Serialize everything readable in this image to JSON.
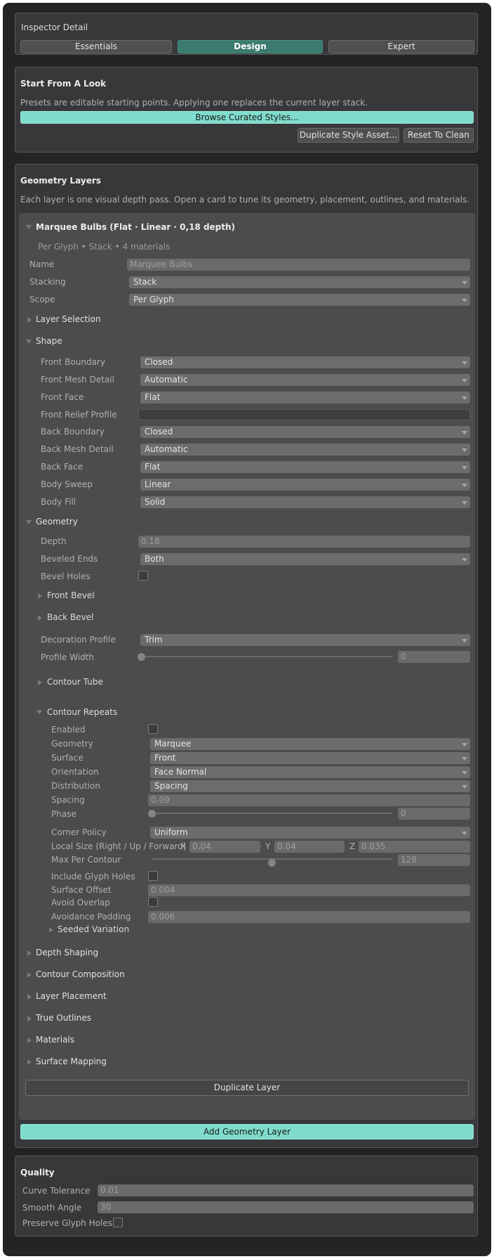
{
  "header": {
    "title": "Inspector Detail",
    "tabs": [
      "Essentials",
      "Design",
      "Expert"
    ],
    "active_tab": "Design"
  },
  "look": {
    "title": "Start From A Look",
    "desc": "Presets are editable starting points. Applying one replaces the current layer stack.",
    "browse": "Browse Curated Styles...",
    "duplicate": "Duplicate Style Asset...",
    "reset": "Reset To Clean"
  },
  "layers": {
    "title": "Geometry Layers",
    "desc": "Each layer is one visual depth pass. Open a card to tune its geometry, placement, outlines, and materials.",
    "add": "Add Geometry Layer"
  },
  "card": {
    "title": "Marquee Bulbs (Flat · Linear · 0,18 depth)",
    "subtitle": "Per Glyph • Stack • 4 materials",
    "name_label": "Name",
    "name_value": "Marquee Bulbs",
    "stacking_label": "Stacking",
    "stacking_value": "Stack",
    "scope_label": "Scope",
    "scope_value": "Per Glyph",
    "layer_selection": "Layer Selection",
    "shape": {
      "title": "Shape",
      "rows": [
        {
          "label": "Front Boundary",
          "value": "Closed"
        },
        {
          "label": "Front Mesh Detail",
          "value": "Automatic"
        },
        {
          "label": "Front Face",
          "value": "Flat"
        },
        {
          "label": "Front Relief Profile",
          "value": ""
        },
        {
          "label": "Back Boundary",
          "value": "Closed"
        },
        {
          "label": "Back Mesh Detail",
          "value": "Automatic"
        },
        {
          "label": "Back Face",
          "value": "Flat"
        },
        {
          "label": "Body Sweep",
          "value": "Linear"
        },
        {
          "label": "Body Fill",
          "value": "Solid"
        }
      ]
    },
    "geometry": {
      "title": "Geometry",
      "depth_label": "Depth",
      "depth_value": "0.18",
      "beveled_label": "Beveled Ends",
      "beveled_value": "Both",
      "bevel_holes_label": "Bevel Holes",
      "front_bevel": "Front Bevel",
      "back_bevel": "Back Bevel",
      "decoration_label": "Decoration Profile",
      "decoration_value": "Trim",
      "profile_width_label": "Profile Width",
      "profile_width_value": "0",
      "profile_width_fraction": 0,
      "contour_tube": "Contour Tube",
      "repeats": {
        "title": "Contour Repeats",
        "enabled_label": "Enabled",
        "geometry_label": "Geometry",
        "geometry_value": "Marquee",
        "surface_label": "Surface",
        "surface_value": "Front",
        "orientation_label": "Orientation",
        "orientation_value": "Face Normal",
        "distribution_label": "Distribution",
        "distribution_value": "Spacing",
        "spacing_label": "Spacing",
        "spacing_value": "0.09",
        "phase_label": "Phase",
        "phase_value": "0",
        "phase_fraction": 0,
        "corner_label": "Corner Policy",
        "corner_value": "Uniform",
        "local_size_label": "Local Size (Right / Up / Forward)",
        "x_label": "X",
        "x_value": "0.04",
        "y_label": "Y",
        "y_value": "0.04",
        "z_label": "Z",
        "z_value": "0.035",
        "max_label": "Max Per Contour",
        "max_value": "128",
        "max_fraction": 0.5,
        "include_holes_label": "Include Glyph Holes",
        "surface_offset_label": "Surface Offset",
        "surface_offset_value": "0.004",
        "avoid_overlap_label": "Avoid Overlap",
        "avoid_padding_label": "Avoidance Padding",
        "avoid_padding_value": "0.006",
        "seeded": "Seeded Variation"
      }
    },
    "sections": [
      "Depth Shaping",
      "Contour Composition",
      "Layer Placement",
      "True Outlines",
      "Materials",
      "Surface Mapping"
    ],
    "duplicate": "Duplicate Layer"
  },
  "quality": {
    "title": "Quality",
    "curve_label": "Curve Tolerance",
    "curve_value": "0.01",
    "smooth_label": "Smooth Angle",
    "smooth_value": "30",
    "preserve_label": "Preserve Glyph Holes"
  },
  "colors": {
    "accent_teal": "#7fdccc",
    "active_tab": "#3b7a6f",
    "background": "#242426",
    "panel": "#38383a",
    "card": "#4c4c4e"
  }
}
